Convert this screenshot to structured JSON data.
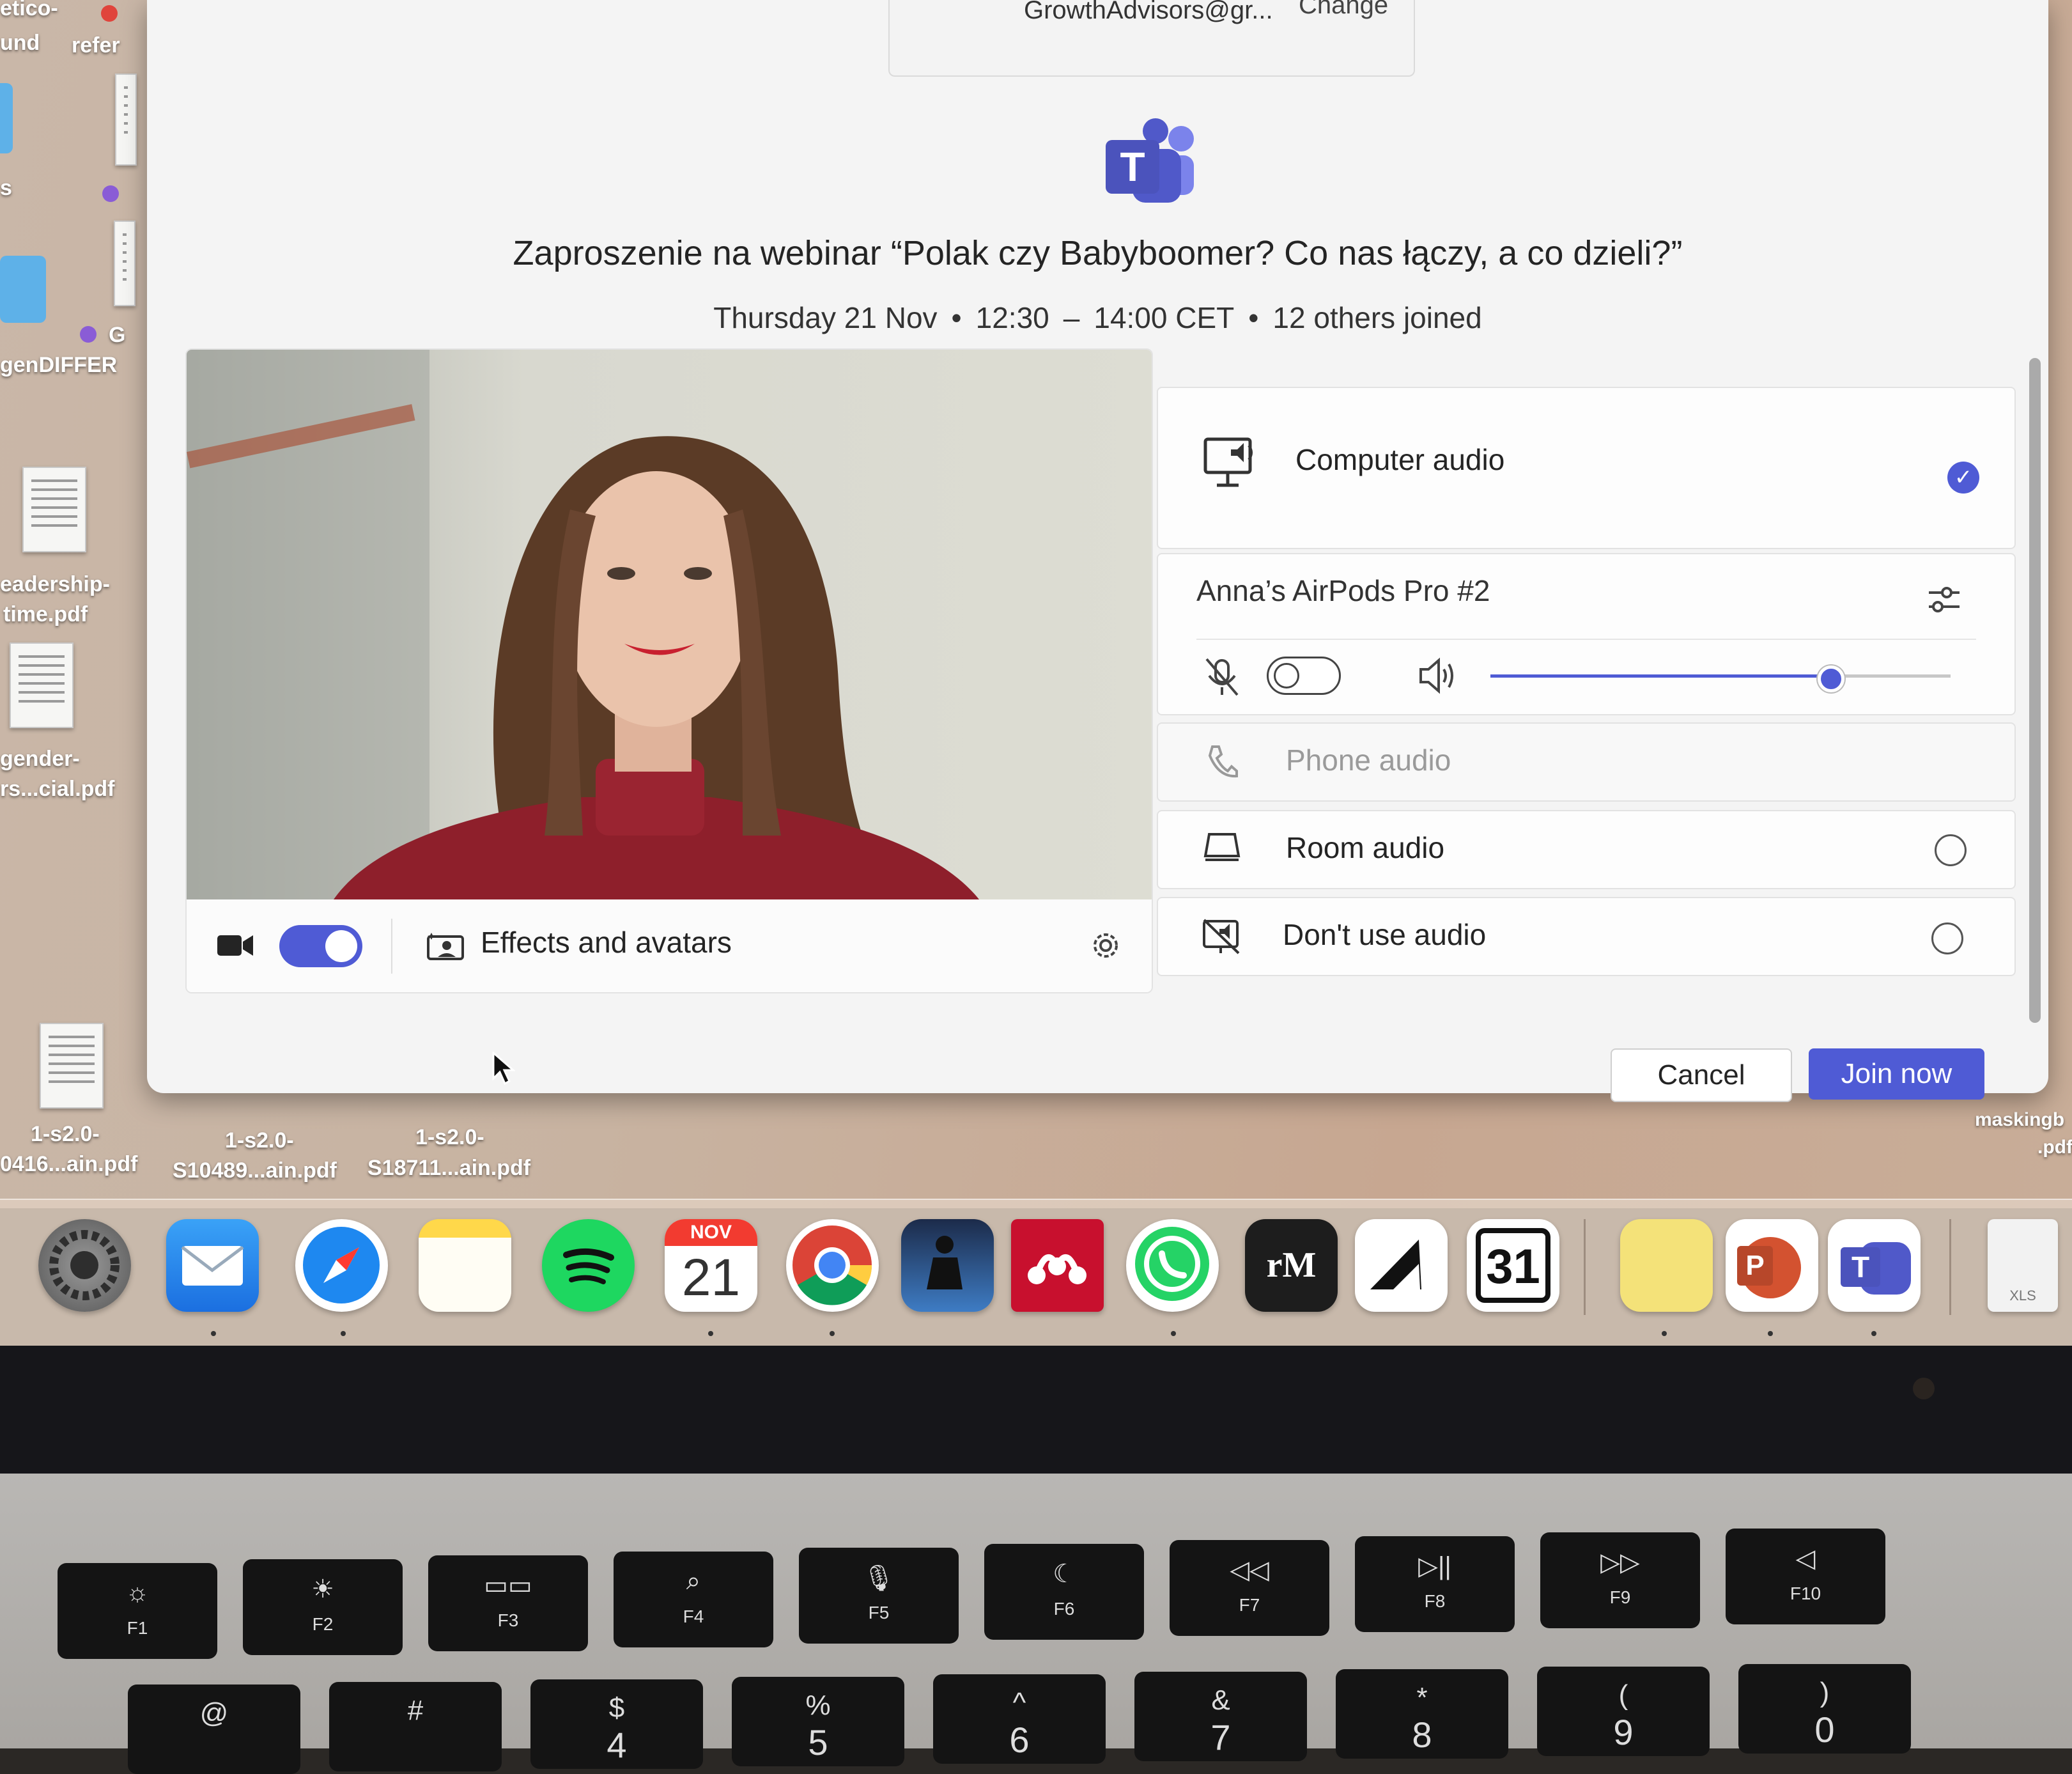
{
  "desktop": {
    "labels": {
      "top_left_1": "etico-",
      "top_left_2": "und",
      "top_left_3": "refer",
      "top_left_4": "s",
      "g_label": "G",
      "gen_differ": "genDIFFER",
      "leadership_1": "eadership-",
      "leadership_2": "time.pdf",
      "gender_1": "gender-",
      "gender_2": "rs...cial.pdf",
      "file1_1": "1-s2.0-",
      "file1_2": "0416...ain.pdf",
      "file2_1": "1-s2.0-",
      "file2_2": "S10489...ain.pdf",
      "file3_1": "1-s2.0-",
      "file3_2": "S18711...ain.pdf",
      "masking_1": "maskingb",
      "masking_2": ".pdf"
    }
  },
  "account": {
    "email": "GrowthAdvisors@gr...",
    "change": "Change"
  },
  "meeting": {
    "title": "Zaproszenie na webinar “Polak czy Babyboomer? Co nas łączy, a co dzieli?”",
    "day": "Thursday 21 Nov",
    "start": "12:30",
    "dash": "–",
    "end": "14:00 CET",
    "joined": "12 others joined",
    "separator": "•"
  },
  "video": {
    "camera_on": true,
    "effects_label": "Effects and avatars",
    "icons": {
      "camera": "video-camera-icon",
      "effects": "effects-icon",
      "settings": "gear-icon"
    }
  },
  "audio": {
    "computer_audio": "Computer audio",
    "computer_audio_selected": true,
    "device_name": "Anna’s AirPods Pro #2",
    "mic_muted": true,
    "volume_level": 0.74,
    "phone_audio": "Phone audio",
    "room_audio": "Room audio",
    "dont_use_audio": "Don't use audio",
    "check_glyph": "✓"
  },
  "actions": {
    "cancel": "Cancel",
    "join": "Join now"
  },
  "dock": {
    "calendar_month": "NOV",
    "calendar_day": "21",
    "remarkable_label": "rM",
    "calendar31": "31",
    "xls_label": "XLS",
    "powerpoint_letter": "P",
    "teams_letter": "T"
  },
  "keyboard": {
    "fkeys": [
      "F1",
      "F2",
      "F3",
      "F4",
      "F5",
      "F6",
      "F7",
      "F8",
      "F9",
      "F10"
    ],
    "fglyphs": [
      "☼",
      "☀",
      "▭▭",
      "⌕",
      "🎙",
      "☾",
      "◁◁",
      "▷||",
      "▷▷",
      "◁"
    ],
    "numtop": [
      "@",
      "#",
      "$",
      "%",
      "^",
      "&",
      "*",
      "(",
      ")"
    ],
    "numbottom": [
      "",
      "",
      "4",
      "5",
      "6",
      "7",
      "8",
      "9",
      "0"
    ]
  },
  "colors": {
    "accent": "#4f5bd5",
    "window_bg": "#f4f4f4"
  }
}
